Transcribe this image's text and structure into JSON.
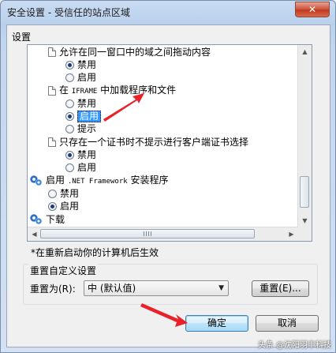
{
  "window": {
    "title": "安全设置 - 受信任的站点区域",
    "close_glyph": "✕"
  },
  "settings": {
    "group_label": "设置",
    "items": [
      {
        "kind": "doc",
        "label": "允许在同一窗口中的域之间拖动内容"
      },
      {
        "kind": "radio",
        "label": "禁用",
        "checked": true
      },
      {
        "kind": "radio",
        "label": "启用",
        "checked": false
      },
      {
        "kind": "doc",
        "label": "在 IFRAME 中加载程序和文件"
      },
      {
        "kind": "radio",
        "label": "禁用",
        "checked": false
      },
      {
        "kind": "radio",
        "label": "启用",
        "checked": true,
        "focused": true
      },
      {
        "kind": "radio",
        "label": "提示",
        "checked": false
      },
      {
        "kind": "doc",
        "label": "只存在一个证书时不提示进行客户端证书选择"
      },
      {
        "kind": "radio",
        "label": "禁用",
        "checked": true
      },
      {
        "kind": "radio",
        "label": "启用",
        "checked": false
      },
      {
        "kind": "gear",
        "label": "启用 .NET Framework 安装程序"
      },
      {
        "kind": "radio",
        "label": "禁用",
        "checked": false
      },
      {
        "kind": "radio",
        "label": "启用",
        "checked": true
      },
      {
        "kind": "gear",
        "label": "下载"
      }
    ],
    "scroll_up_glyph": "▲",
    "scroll_down_glyph": "▼",
    "scroll_left_glyph": "◀",
    "scroll_right_glyph": "▶"
  },
  "restart_note": "*在重新启动你的计算机后生效",
  "reset": {
    "group_label": "重置自定义设置",
    "reset_to_label": "重置为(R):",
    "selected_option": "中 (默认值)",
    "dropdown_glyph": "▼",
    "reset_button": "重置(E)..."
  },
  "buttons": {
    "ok": "确定",
    "cancel": "取消"
  },
  "annotation_color": "#e8212a",
  "watermark": "头条 @沈阳羽丰科技"
}
